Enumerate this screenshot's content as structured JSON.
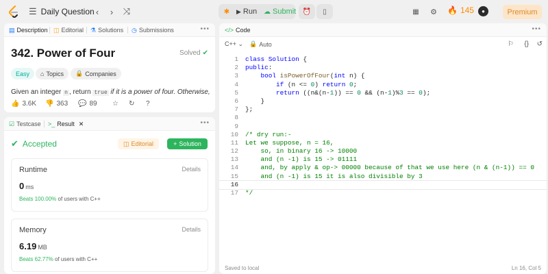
{
  "topbar": {
    "title": "Daily Question",
    "run_label": "Run",
    "submit_label": "Submit",
    "streak_count": "145",
    "premium_label": "Premium"
  },
  "description": {
    "tabs": [
      "Description",
      "Editorial",
      "Solutions",
      "Submissions"
    ],
    "title": "342. Power of Four",
    "status": "Solved",
    "tags": [
      "Easy",
      "Topics",
      "Companies"
    ],
    "text_before": "Given an integer ",
    "code1": "n",
    "text_mid": ", return ",
    "code2": "true",
    "text_after": " if it is a power of four. Otherwise,",
    "likes": "3.6K",
    "dislikes": "363",
    "comments": "89"
  },
  "result": {
    "tabs": [
      "Testcase",
      "Result"
    ],
    "status": "Accepted",
    "editorial_label": "Editorial",
    "solution_label": "Solution",
    "runtime": {
      "label": "Runtime",
      "details": "Details",
      "value": "0",
      "unit": "ms",
      "beats_pct": "Beats 100.00%",
      "beats_rest": " of users with C++"
    },
    "memory": {
      "label": "Memory",
      "details": "Details",
      "value": "6.19",
      "unit": "MB",
      "beats_pct": "Beats 62.77%",
      "beats_rest": " of users with C++"
    }
  },
  "code": {
    "tab": "Code",
    "language": "C++",
    "mode": "Auto",
    "saved": "Saved to local",
    "position": "Ln 16, Col 5",
    "current_line": 16,
    "lines": [
      [
        [
          "kw",
          "class"
        ],
        [
          "op",
          " "
        ],
        [
          "ty",
          "Solution"
        ],
        [
          "op",
          " {"
        ]
      ],
      [
        [
          "kw",
          "public"
        ],
        [
          "op",
          ":"
        ]
      ],
      [
        [
          "op",
          "    "
        ],
        [
          "kw",
          "bool"
        ],
        [
          "op",
          " "
        ],
        [
          "fn",
          "isPowerOfFour"
        ],
        [
          "op",
          "("
        ],
        [
          "kw",
          "int"
        ],
        [
          "op",
          " n) {"
        ]
      ],
      [
        [
          "op",
          "        "
        ],
        [
          "kw",
          "if"
        ],
        [
          "op",
          " (n <= "
        ],
        [
          "num",
          "0"
        ],
        [
          "op",
          ") "
        ],
        [
          "kw",
          "return"
        ],
        [
          "op",
          " "
        ],
        [
          "num",
          "0"
        ],
        [
          "op",
          ";"
        ]
      ],
      [
        [
          "op",
          "        "
        ],
        [
          "kw",
          "return"
        ],
        [
          "op",
          " ((n&(n-"
        ],
        [
          "num",
          "1"
        ],
        [
          "op",
          ")) == "
        ],
        [
          "num",
          "0"
        ],
        [
          "op",
          " && (n-"
        ],
        [
          "num",
          "1"
        ],
        [
          "op",
          ")%"
        ],
        [
          "num",
          "3"
        ],
        [
          "op",
          " == "
        ],
        [
          "num",
          "0"
        ],
        [
          "op",
          ");"
        ]
      ],
      [
        [
          "op",
          "    }"
        ]
      ],
      [
        [
          "op",
          "};"
        ]
      ],
      [
        [
          "op",
          ""
        ]
      ],
      [
        [
          "op",
          ""
        ]
      ],
      [
        [
          "cm",
          "/* dry run:-"
        ]
      ],
      [
        [
          "cm",
          "Let we suppose, n = 16,"
        ]
      ],
      [
        [
          "cm",
          "    so, in binary 16 -> 10000"
        ]
      ],
      [
        [
          "cm",
          "    and (n -1) is 15 -> 01111"
        ]
      ],
      [
        [
          "cm",
          "    and, by apply & op-> 00000 because of that we use here (n & (n-1)) == 0"
        ]
      ],
      [
        [
          "cm",
          "    and (n -1) is 15 it is also divisible by 3"
        ]
      ],
      [
        [
          "cm",
          ""
        ]
      ],
      [
        [
          "cm",
          "*/"
        ]
      ]
    ]
  }
}
